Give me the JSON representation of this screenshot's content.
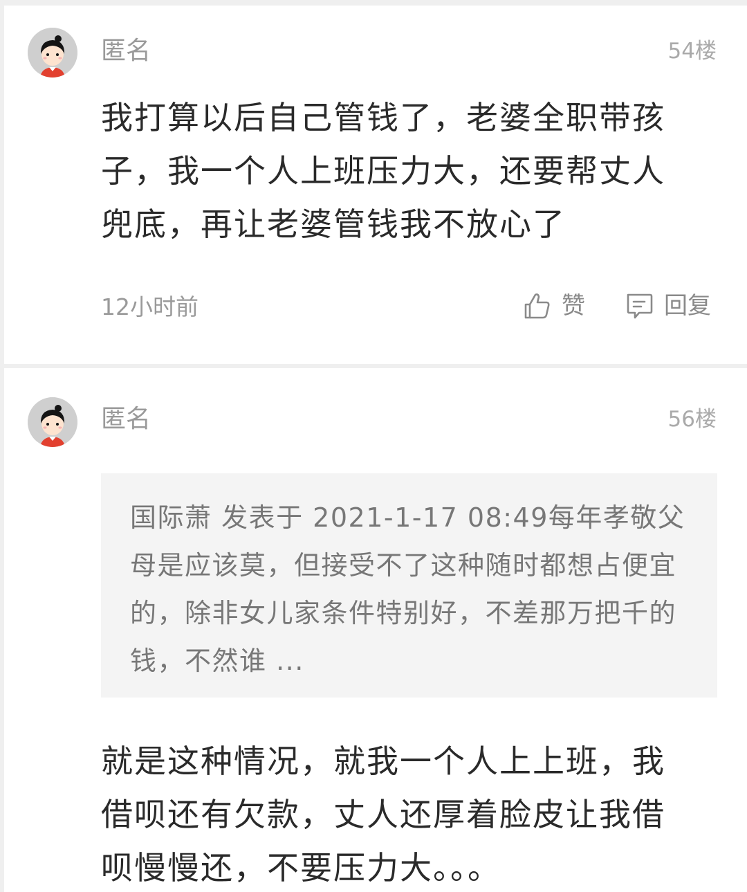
{
  "comments": [
    {
      "author": "匿名",
      "floor": "54楼",
      "content": "我打算以后自己管钱了，老婆全职带孩子，我一个人上班压力大，还要帮丈人兜底，再让老婆管钱我不放心了",
      "time": "12小时前",
      "like_label": "赞",
      "reply_label": "回复",
      "icons": {
        "avatar": "anonymous-avatar",
        "like": "thumbs-up-icon",
        "reply": "comment-bubble-icon"
      }
    },
    {
      "author": "匿名",
      "floor": "56楼",
      "quote": "国际萧 发表于 2021-1-17 08:49每年孝敬父母是应该莫，但接受不了这种随时都想占便宜的，除非女儿家条件特别好，不差那万把千的钱，不然谁 ...",
      "content": "就是这种情况，就我一个人上上班，我借呗还有欠款，丈人还厚着脸皮让我借呗慢慢还，不要压力大。。。",
      "icons": {
        "avatar": "anonymous-avatar"
      }
    }
  ],
  "colors": {
    "background": "#efefef",
    "card": "#ffffff",
    "text_primary": "#2a2a2a",
    "text_secondary": "#9a9a9a",
    "quote_bg": "#f4f4f4"
  }
}
